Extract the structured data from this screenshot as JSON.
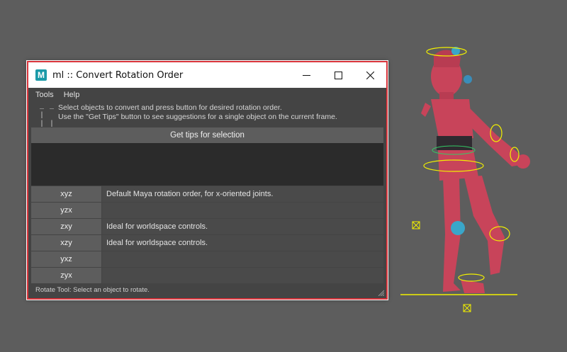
{
  "window": {
    "title": "ml :: Convert Rotation Order",
    "icon_letter": "M",
    "controls": [
      "minimize-icon",
      "maximize-icon",
      "close-icon"
    ]
  },
  "menubar": {
    "items": [
      "Tools",
      "Help"
    ]
  },
  "info": {
    "icon_text": "_ _ |\n| | | |",
    "line1": "Select objects to convert and press button for desired rotation order.",
    "line2": "Use the \"Get Tips\" button to see suggestions for a single object on the current frame."
  },
  "tips_button": {
    "label": "Get tips for selection"
  },
  "orders": [
    {
      "label": "xyz",
      "desc": "Default Maya rotation order, for x-oriented joints."
    },
    {
      "label": "yzx",
      "desc": ""
    },
    {
      "label": "zxy",
      "desc": "Ideal for worldspace controls."
    },
    {
      "label": "xzy",
      "desc": "Ideal for worldspace controls."
    },
    {
      "label": "yxz",
      "desc": ""
    },
    {
      "label": "zyx",
      "desc": ""
    }
  ],
  "status": {
    "text": "Rotate Tool: Select an object to rotate."
  },
  "colors": {
    "viewport_bg": "#5d5d5d",
    "window_border": "#d8343b",
    "character_body": "#c8445a",
    "rig_controls": "#f2f000"
  }
}
